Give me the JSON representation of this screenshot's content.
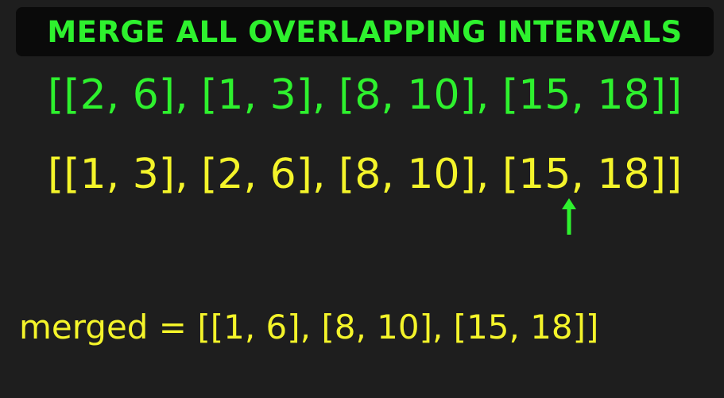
{
  "title": "MERGE ALL OVERLAPPING INTERVALS",
  "input_intervals": "[[2, 6], [1, 3], [8, 10], [15, 18]]",
  "sorted_intervals": "[[1, 3], [2, 6], [8, 10], [15, 18]]",
  "merged_line": "merged = [[1, 6], [8, 10], [15, 18]]",
  "colors": {
    "background": "#1e1e1e",
    "title_bar": "#0a0a0a",
    "green": "#2ef12e",
    "yellow": "#f4f42a"
  },
  "icons": {
    "pointer": "up-arrow-icon"
  }
}
